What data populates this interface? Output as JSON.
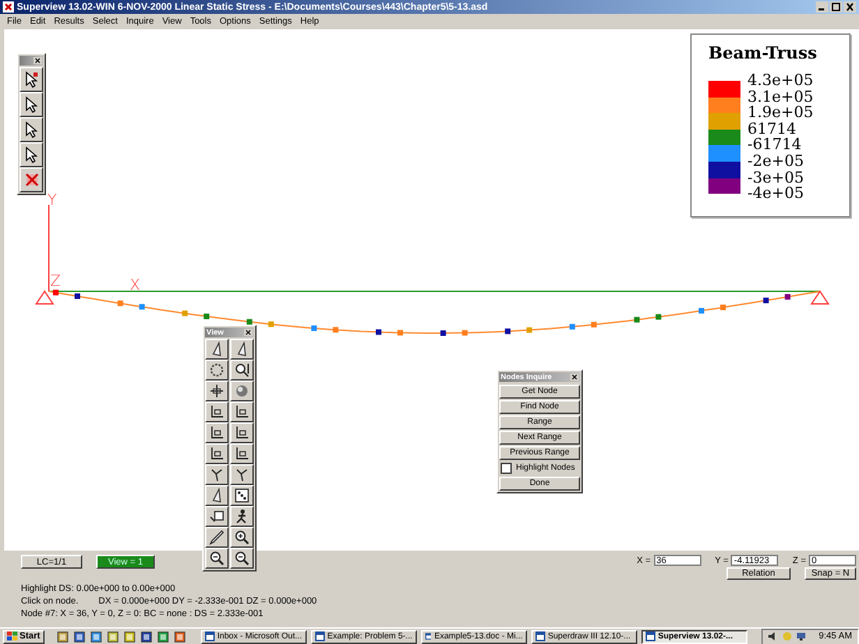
{
  "window": {
    "title": "Superview 13.02-WIN 6-NOV-2000 Linear Static Stress - E:\\Documents\\Courses\\443\\Chapter5\\5-13.asd"
  },
  "menu": [
    "File",
    "Edit",
    "Results",
    "Select",
    "Inquire",
    "View",
    "Tools",
    "Options",
    "Settings",
    "Help"
  ],
  "canvas": {
    "axis_labels": [
      "Y",
      "Z",
      "X"
    ],
    "nodes": [
      {
        "color": "#ff0000"
      },
      {
        "color": "#1010a0"
      },
      {
        "color": "#ff7f1f"
      },
      {
        "color": "#1e90ff"
      },
      {
        "color": "#e0a000"
      },
      {
        "color": "#1a8a1a"
      },
      {
        "color": "#1a8a1a"
      },
      {
        "color": "#e0a000"
      },
      {
        "color": "#1e90ff"
      },
      {
        "color": "#ff7f1f"
      },
      {
        "color": "#1010a0"
      },
      {
        "color": "#ff7f1f"
      },
      {
        "color": "#1010a0"
      },
      {
        "color": "#ff7f1f"
      },
      {
        "color": "#1010a0"
      },
      {
        "color": "#e0a000"
      },
      {
        "color": "#1e90ff"
      },
      {
        "color": "#ff7f1f"
      },
      {
        "color": "#1a8a1a"
      },
      {
        "color": "#1a8a1a"
      },
      {
        "color": "#1e90ff"
      },
      {
        "color": "#ff7f1f"
      },
      {
        "color": "#1010a0"
      },
      {
        "color": "#800080"
      }
    ]
  },
  "legend": {
    "title": "Beam-Truss",
    "labels": [
      "4.3e+05",
      "3.1e+05",
      "1.9e+05",
      "61714",
      "-61714",
      "-2e+05",
      "-3e+05",
      "-4e+05"
    ],
    "bands": [
      {
        "color": "#ff0000"
      },
      {
        "color": "#ff7f1f"
      },
      {
        "color": "#e0a000"
      },
      {
        "color": "#1a8a1a"
      },
      {
        "color": "#1e90ff"
      },
      {
        "color": "#1010a0"
      },
      {
        "color": "#800080"
      }
    ]
  },
  "view_palette": {
    "title": "View"
  },
  "nodes_palette": {
    "title": "Nodes Inquire",
    "buttons": [
      "Get Node",
      "Find Node",
      "Range",
      "Next Range",
      "Previous Range"
    ],
    "highlight": {
      "label": "Highlight Nodes",
      "checked": false
    },
    "done": "Done"
  },
  "bottom": {
    "lc_button": "LC=1/1",
    "view_button": "View = 1",
    "status": [
      "Highlight DS: 0.00e+000 to 0.00e+000",
      "Click on node.        DX = 0.000e+000 DY = -2.333e-001 DZ = 0.000e+000",
      "Node #7: X = 36, Y = 0, Z = 0: BC = none : DS = 2.333e-001"
    ],
    "coords": [
      {
        "label": "X =",
        "value": "36"
      },
      {
        "label": "Y =",
        "value": "-4.11923"
      },
      {
        "label": "Z =",
        "value": "0"
      }
    ],
    "relation_button": "Relation",
    "snap_button": "Snap = N"
  },
  "taskbar": {
    "start": "Start",
    "tasks": [
      {
        "label": "Inbox - Microsoft Out...",
        "selected": false
      },
      {
        "label": "Example: Problem 5-...",
        "selected": false
      },
      {
        "label": "Example5-13.doc - Mi...",
        "selected": false
      },
      {
        "label": "Superdraw III 12.10-...",
        "selected": false
      },
      {
        "label": "Superview 13.02-...",
        "selected": true
      }
    ],
    "clock": "9:45 AM"
  }
}
